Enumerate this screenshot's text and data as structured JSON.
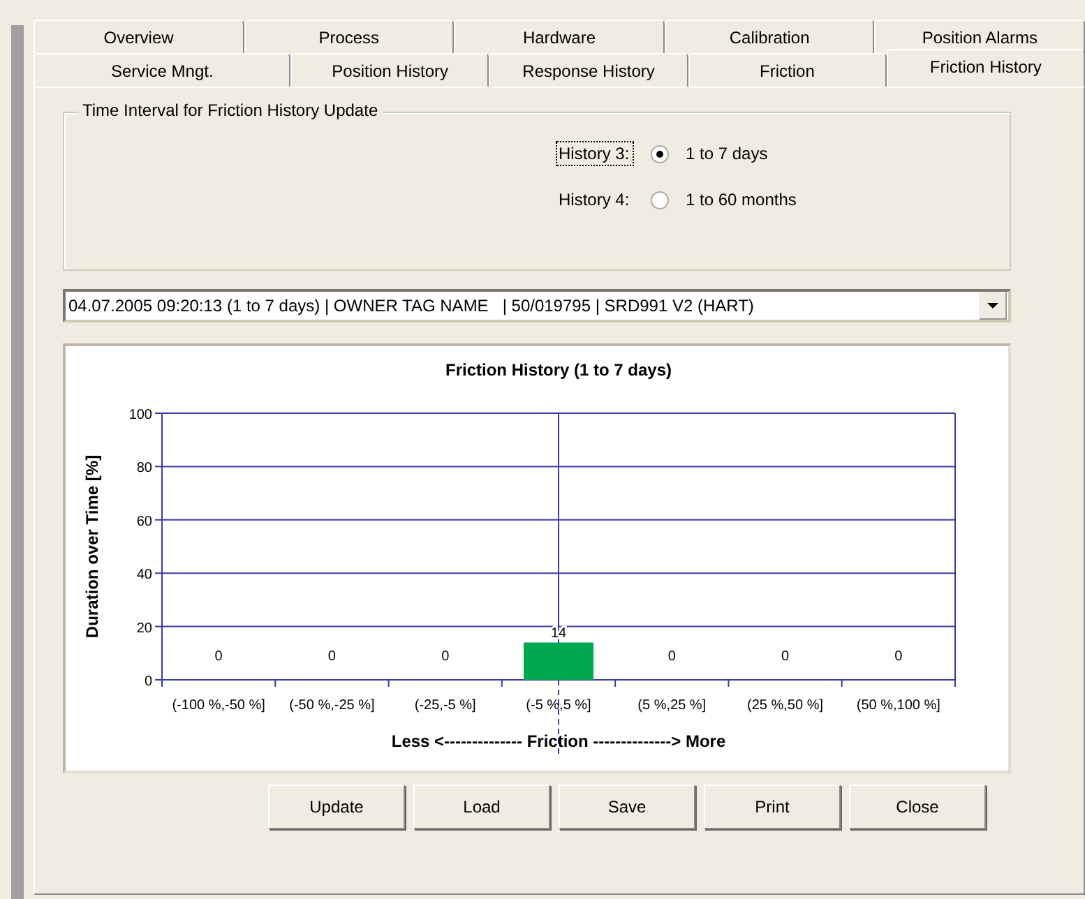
{
  "tab_rows": [
    [
      {
        "label": "Overview",
        "selected": false
      },
      {
        "label": "Process",
        "selected": false
      },
      {
        "label": "Hardware",
        "selected": false
      },
      {
        "label": "Calibration",
        "selected": false
      },
      {
        "label": "Position Alarms",
        "selected": false
      }
    ],
    [
      {
        "label": "Service Mngt.",
        "selected": false
      },
      {
        "label": "Position History",
        "selected": false
      },
      {
        "label": "Response History",
        "selected": false
      },
      {
        "label": "Friction",
        "selected": false
      },
      {
        "label": "Friction History",
        "selected": true
      }
    ]
  ],
  "interval_group": {
    "title": "Time Interval for Friction History Update",
    "options": [
      {
        "label": "History 3:",
        "option": "1 to 7 days",
        "selected": true,
        "focused": true
      },
      {
        "label": "History 4:",
        "option": "1 to 60 months",
        "selected": false,
        "focused": false
      }
    ]
  },
  "record_select": {
    "value": "04.07.2005 09:20:13 (1 to 7 days) | OWNER TAG NAME   | 50/019795 | SRD991 V2 (HART)"
  },
  "chart": {
    "chart_data": {
      "type": "bar",
      "title": "Friction History (1 to 7 days)",
      "xlabel": "Less <-------------- Friction --------------> More",
      "ylabel": "Duration over Time [%]",
      "categories": [
        "(-100 %,-50 %]",
        "(-50 %,-25 %]",
        "(-25,-5 %]",
        "(-5 %,5 %]",
        "(5 %,25 %]",
        "(25 %,50 %]",
        "(50 %,100 %]"
      ],
      "series": [
        {
          "color": "#00a650",
          "values": [
            0,
            0,
            0,
            14,
            0,
            0,
            0
          ]
        }
      ],
      "grid": true,
      "ylim": [
        0,
        100
      ],
      "yticks": [
        0,
        20,
        40,
        60,
        80,
        100
      ],
      "data_labels": true
    }
  },
  "buttons": [
    "Update",
    "Load",
    "Save",
    "Print",
    "Close"
  ]
}
